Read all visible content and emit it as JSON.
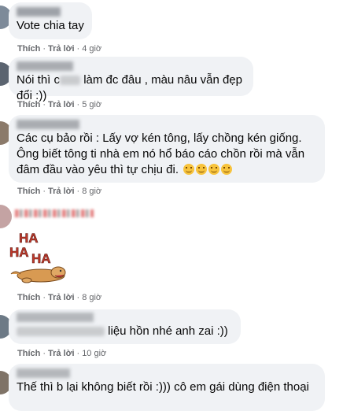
{
  "comments": [
    {
      "text": "Vote chia tay",
      "like": "Thích",
      "reply": "Trả lời",
      "time": "4 giờ"
    },
    {
      "text_before": "Nói thì c",
      "text_after": " làm đc đâu , màu nâu vẫn đẹp đổi :))",
      "like": "Thích",
      "reply": "Trả lời",
      "time": "5 giờ"
    },
    {
      "text": "Các cụ bảo rồi : Lấy vợ kén tông, lấy chồng kén giống.\nÔng biết tông ti nhà em nó hổ báo cáo chồn rồi mà vẫn\nđâm đầu vào yêu thì tự chịu đi.",
      "like": "Thích",
      "reply": "Trả lời",
      "time": "8 giờ"
    },
    {
      "sticker_text": "HAHAHA",
      "like": "Thích",
      "reply": "Trả lời",
      "time": "8 giờ"
    },
    {
      "text": " liệu hồn nhé anh zai :))",
      "like": "Thích",
      "reply": "Trả lời",
      "time": "10 giờ"
    },
    {
      "text": "Thế thì b lại không biết rồi :))) cô em gái dùng điện thoại"
    }
  ],
  "colors": {
    "bubble": "#f0f2f5",
    "meta": "#65676b",
    "text": "#050505",
    "sticker_red": "#c0392b"
  },
  "icons": {
    "emoji": "relieved-face-emoji"
  }
}
